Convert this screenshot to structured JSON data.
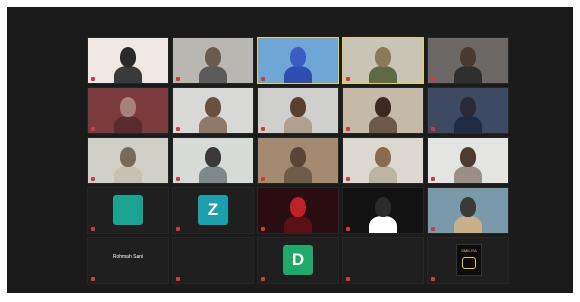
{
  "meeting": {
    "tiles": [
      {
        "name": "",
        "kind": "video",
        "bg": "#efe8e4",
        "head": "#2a2a2a",
        "body": "#3a3a3a"
      },
      {
        "name": "",
        "kind": "video",
        "bg": "#b9b7b1",
        "head": "#6a5a50",
        "body": "#5b5b5b"
      },
      {
        "name": "",
        "kind": "video",
        "bg": "#6fa6d6",
        "head": "#3b5dc1",
        "body": "#2f4fb0",
        "active": true
      },
      {
        "name": "",
        "kind": "video",
        "bg": "#c8c5b6",
        "head": "#8a7a5a",
        "body": "#5c6b44",
        "active": true
      },
      {
        "name": "",
        "kind": "video",
        "bg": "#6c6865",
        "head": "#4a3a30",
        "body": "#2e2e2e"
      },
      {
        "name": "",
        "kind": "video",
        "bg": "#7a3a3e",
        "head": "#a8807c",
        "body": "#5a2a2e"
      },
      {
        "name": "",
        "kind": "video",
        "bg": "#d8d8d6",
        "head": "#6a5040",
        "body": "#8f7a6a"
      },
      {
        "name": "",
        "kind": "video",
        "bg": "#cfcfcd",
        "head": "#5a4030",
        "body": "#b0a090"
      },
      {
        "name": "",
        "kind": "video",
        "bg": "#c5b9a7",
        "head": "#3a2a22",
        "body": "#6b5a4a"
      },
      {
        "name": "",
        "kind": "video",
        "bg": "#3e4a62",
        "head": "#2a2a3a",
        "body": "#1f2a44"
      },
      {
        "name": "",
        "kind": "video",
        "bg": "#d0cfc8",
        "head": "#7a6a5a",
        "body": "#c8c0b0"
      },
      {
        "name": "",
        "kind": "video",
        "bg": "#d7dbd8",
        "head": "#3a3838",
        "body": "#7e8a8a"
      },
      {
        "name": "",
        "kind": "video",
        "bg": "#a38a70",
        "head": "#5a4535",
        "body": "#6e5b48"
      },
      {
        "name": "",
        "kind": "video",
        "bg": "#ddd8cf",
        "head": "#8a6a50",
        "body": "#bdb3a3"
      },
      {
        "name": "",
        "kind": "video",
        "bg": "#e4e4e2",
        "head": "#4b3b30",
        "body": "#9a8f86"
      },
      {
        "name": "",
        "kind": "avatar",
        "letter": "",
        "color": "#1aa392"
      },
      {
        "name": "",
        "kind": "avatar",
        "letter": "Z",
        "color": "#1d9fb0"
      },
      {
        "name": "",
        "kind": "video",
        "bg": "#2a0e12",
        "head": "#c0202a",
        "body": "#5a1015"
      },
      {
        "name": "",
        "kind": "video",
        "bg": "#121212",
        "head": "#2b2b2b",
        "body": "#ffffff"
      },
      {
        "name": "",
        "kind": "video",
        "bg": "#7a9aaa",
        "head": "#3a3a3a",
        "body": "#c9b08a"
      },
      {
        "name": "",
        "kind": "text",
        "label": "Rohmah Sani"
      },
      {
        "name": "",
        "kind": "text",
        "label": ""
      },
      {
        "name": "",
        "kind": "avatar",
        "letter": "D",
        "color": "#20a86a"
      },
      {
        "name": "",
        "kind": "text",
        "label": ""
      },
      {
        "name": "",
        "kind": "logo",
        "label": "SMILIYA"
      }
    ]
  }
}
